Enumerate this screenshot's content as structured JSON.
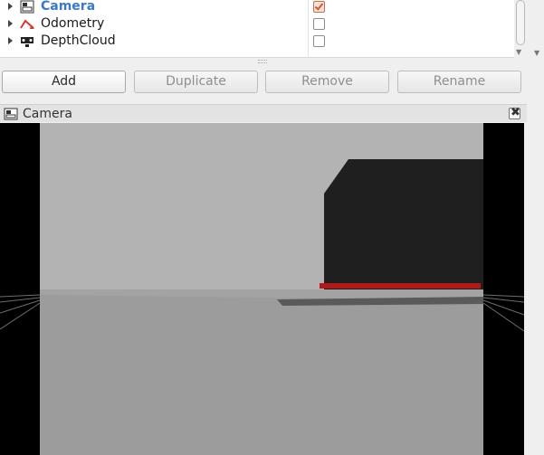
{
  "displays": {
    "items": [
      {
        "label": "Camera",
        "icon": "camera-icon",
        "checked": true,
        "selected": true
      },
      {
        "label": "Odometry",
        "icon": "odometry-arrow-icon",
        "checked": false,
        "selected": false
      },
      {
        "label": "DepthCloud",
        "icon": "depthcloud-icon",
        "checked": false,
        "selected": false
      }
    ]
  },
  "buttons": {
    "add": "Add",
    "duplicate": "Duplicate",
    "remove": "Remove",
    "rename": "Rename"
  },
  "camera_panel": {
    "title": "Camera",
    "close_symbol": "✖"
  },
  "colors": {
    "selected_text": "#3b78c9",
    "checkbox_tick": "#d9572b",
    "odometry_arrow": "#d33a2c",
    "laser_points": "#b21a1a"
  }
}
